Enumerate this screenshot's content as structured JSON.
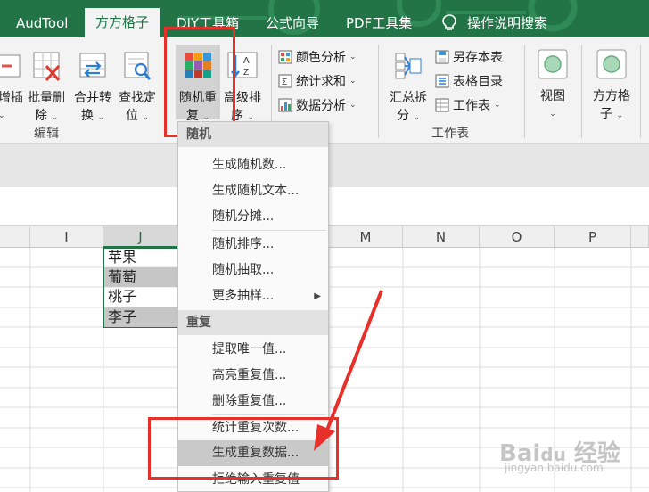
{
  "tabs": [
    {
      "label": "AudTool"
    },
    {
      "label": "方方格子"
    },
    {
      "label": "DIY工具箱"
    },
    {
      "label": "公式向导"
    },
    {
      "label": "PDF工具集"
    },
    {
      "label": "操作说明搜索"
    }
  ],
  "ribbon": {
    "btn_insert": "增插",
    "btn_batch_delete_1": "批量删",
    "btn_batch_delete_2": "除",
    "btn_merge_1": "合并转",
    "btn_merge_2": "换",
    "btn_find_1": "查找定",
    "btn_find_2": "位",
    "btn_random_1": "随机重",
    "btn_random_2": "复",
    "btn_sort_1": "高级排",
    "btn_sort_2": "序",
    "color_analysis": "颜色分析",
    "stat_sum": "统计求和",
    "data_analysis": "数据分析",
    "summary_1": "汇总拆",
    "summary_2": "分",
    "save_sheet": "另存本表",
    "sheet_toc": "表格目录",
    "worksheet": "工作表",
    "view": "视图",
    "ffgz_1": "方方格",
    "ffgz_2": "子",
    "group_edit": "编辑",
    "group_worksheet": "工作表"
  },
  "columns": [
    "I",
    "J",
    "M",
    "N",
    "O",
    "P"
  ],
  "cells": [
    "苹果",
    "葡萄",
    "桃子",
    "李子"
  ],
  "menu": {
    "header_random": "随机",
    "items_random": [
      "生成随机数...",
      "生成随机文本...",
      "随机分摊...",
      "随机排序...",
      "随机抽取...",
      "更多抽样..."
    ],
    "header_repeat": "重复",
    "items_repeat": [
      "提取唯一值...",
      "高亮重复值...",
      "删除重复值...",
      "统计重复次数...",
      "生成重复数据...",
      "拒绝输入重复值"
    ]
  },
  "colors": {
    "accent": "#227447",
    "annotation": "#e8302b",
    "highlight": "#c9c9c9"
  }
}
